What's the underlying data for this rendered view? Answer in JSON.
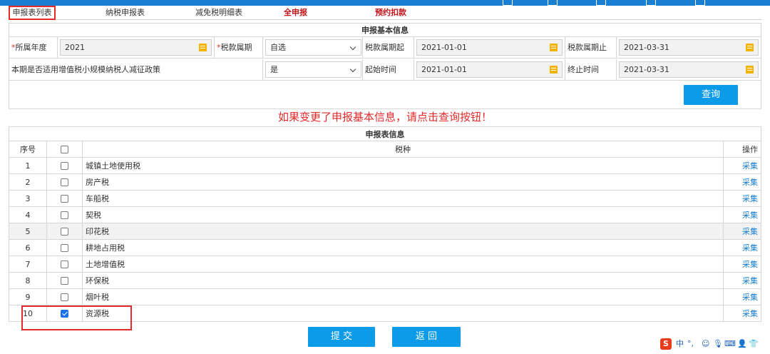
{
  "tabs": [
    {
      "label": "申报表列表",
      "active": true
    },
    {
      "label": "纳税申报表"
    },
    {
      "label": "减免税明细表"
    },
    {
      "label": "全申报",
      "emphasis": true
    },
    {
      "label": "预约扣款",
      "emphasis": true
    }
  ],
  "basic_info": {
    "title": "申报基本信息",
    "row1": {
      "year_label": "所属年度",
      "year_value": "2021",
      "period_type_label": "税款属期",
      "period_type_value": "自选",
      "period_start_label": "税款属期起",
      "period_start_value": "2021-01-01",
      "period_end_label": "税款属期止",
      "period_end_value": "2021-03-31"
    },
    "row2": {
      "policy_label": "本期是否适用增值税小规模纳税人减征政策",
      "policy_value": "是",
      "start_time_label": "起始时间",
      "start_time_value": "2021-01-01",
      "end_time_label": "终止时间",
      "end_time_value": "2021-03-31"
    },
    "query_label": "查询"
  },
  "notice": "如果变更了申报基本信息，请点击查询按钮！",
  "tax_table": {
    "title": "申报表信息",
    "headers": {
      "no": "序号",
      "name": "税种",
      "op": "操作"
    },
    "op_label": "采集",
    "rows": [
      {
        "no": "1",
        "name": "城镇土地使用税",
        "checked": false
      },
      {
        "no": "2",
        "name": "房产税",
        "checked": false
      },
      {
        "no": "3",
        "name": "车船税",
        "checked": false
      },
      {
        "no": "4",
        "name": "契税",
        "checked": false
      },
      {
        "no": "5",
        "name": "印花税",
        "checked": false
      },
      {
        "no": "6",
        "name": "耕地占用税",
        "checked": false
      },
      {
        "no": "7",
        "name": "土地增值税",
        "checked": false
      },
      {
        "no": "8",
        "name": "环保税",
        "checked": false
      },
      {
        "no": "9",
        "name": "烟叶税",
        "checked": false
      },
      {
        "no": "10",
        "name": "资源税",
        "checked": true
      }
    ]
  },
  "actions": {
    "submit_label": "提 交",
    "back_label": "返 回"
  },
  "tray": {
    "ime_lang": "中",
    "ime_punct": "°,"
  },
  "colors": {
    "accent": "#0b9be8",
    "warning": "#e32b2b",
    "link": "#1a7fd0"
  }
}
